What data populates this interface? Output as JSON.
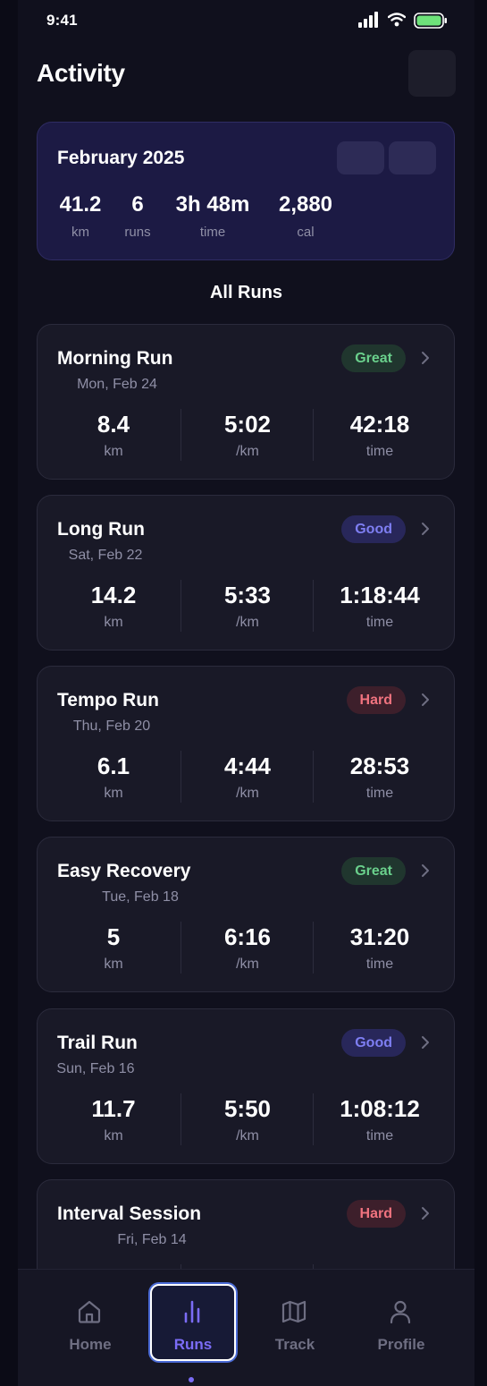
{
  "status": {
    "time": "9:41"
  },
  "header": {
    "title": "Activity"
  },
  "summary": {
    "month": "February 2025",
    "stats": [
      {
        "value": "41.2",
        "label": "km"
      },
      {
        "value": "6",
        "label": "runs"
      },
      {
        "value": "3h 48m",
        "label": "time"
      },
      {
        "value": "2,880",
        "label": "cal"
      }
    ]
  },
  "section": {
    "title": "All Runs"
  },
  "runs": [
    {
      "name": "Morning Run",
      "date": "Mon, Feb 24",
      "badge": "Great",
      "badge_type": "great",
      "distance": "8.4",
      "distance_unit": "km",
      "pace": "5:02",
      "pace_unit": "/km",
      "duration": "42:18",
      "duration_unit": "time"
    },
    {
      "name": "Long Run",
      "date": "Sat, Feb 22",
      "badge": "Good",
      "badge_type": "good",
      "distance": "14.2",
      "distance_unit": "km",
      "pace": "5:33",
      "pace_unit": "/km",
      "duration": "1:18:44",
      "duration_unit": "time"
    },
    {
      "name": "Tempo Run",
      "date": "Thu, Feb 20",
      "badge": "Hard",
      "badge_type": "hard",
      "distance": "6.1",
      "distance_unit": "km",
      "pace": "4:44",
      "pace_unit": "/km",
      "duration": "28:53",
      "duration_unit": "time"
    },
    {
      "name": "Easy Recovery",
      "date": "Tue, Feb 18",
      "badge": "Great",
      "badge_type": "great",
      "distance": "5",
      "distance_unit": "km",
      "pace": "6:16",
      "pace_unit": "/km",
      "duration": "31:20",
      "duration_unit": "time"
    },
    {
      "name": "Trail Run",
      "date": "Sun, Feb 16",
      "badge": "Good",
      "badge_type": "good",
      "distance": "11.7",
      "distance_unit": "km",
      "pace": "5:50",
      "pace_unit": "/km",
      "duration": "1:08:12",
      "duration_unit": "time"
    },
    {
      "name": "Interval Session",
      "date": "Fri, Feb 14",
      "badge": "Hard",
      "badge_type": "hard",
      "distance": "",
      "distance_unit": "",
      "pace": "",
      "pace_unit": "",
      "duration": "",
      "duration_unit": ""
    }
  ],
  "tabs": [
    {
      "label": "Home",
      "icon": "home-icon",
      "active": false
    },
    {
      "label": "Runs",
      "icon": "bar-chart-icon",
      "active": true
    },
    {
      "label": "Track",
      "icon": "map-icon",
      "active": false
    },
    {
      "label": "Profile",
      "icon": "person-icon",
      "active": false
    }
  ],
  "colors": {
    "accent": "#7b6cf6",
    "great": "#6ad08c",
    "good": "#7e7ef2",
    "hard": "#f0737f",
    "battery": "#6ee27a"
  }
}
